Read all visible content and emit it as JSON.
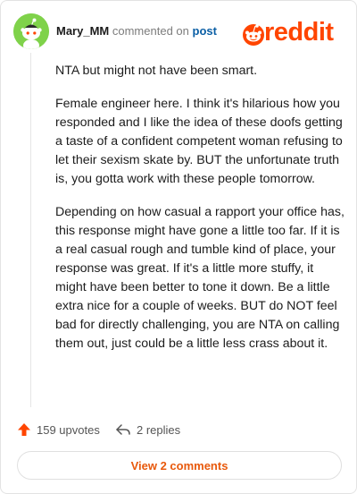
{
  "comment": {
    "username": "Mary_MM",
    "action_text": "commented on",
    "target_link": "post",
    "paragraphs": [
      "NTA but might not have been smart.",
      "Female engineer here. I think it's hilarious how you responded and I like the idea of these doofs getting a taste of a confident competent woman refusing to let their sexism skate by. BUT the unfortunate truth is, you gotta work with these people tomorrow.",
      "Depending on how casual a rapport your office has, this response might have gone a little too far. If it is a real casual rough and tumble kind of place, your response was great. If it's a little more stuffy, it might have been better to tone it down. Be a little extra nice for a couple of weeks. BUT do NOT feel bad for directly challenging, you are NTA on calling them out, just could be a little less crass about it."
    ]
  },
  "brand": {
    "wordmark": "reddit",
    "color": "#ff4500"
  },
  "footer": {
    "upvotes_label": "159 upvotes",
    "replies_label": "2 replies",
    "view_comments_label": "View 2 comments"
  },
  "icons": {
    "avatar": "snoo-avatar-icon",
    "logo": "reddit-alien-icon",
    "upvote": "upvote-arrow-icon",
    "reply": "reply-arrow-icon"
  }
}
